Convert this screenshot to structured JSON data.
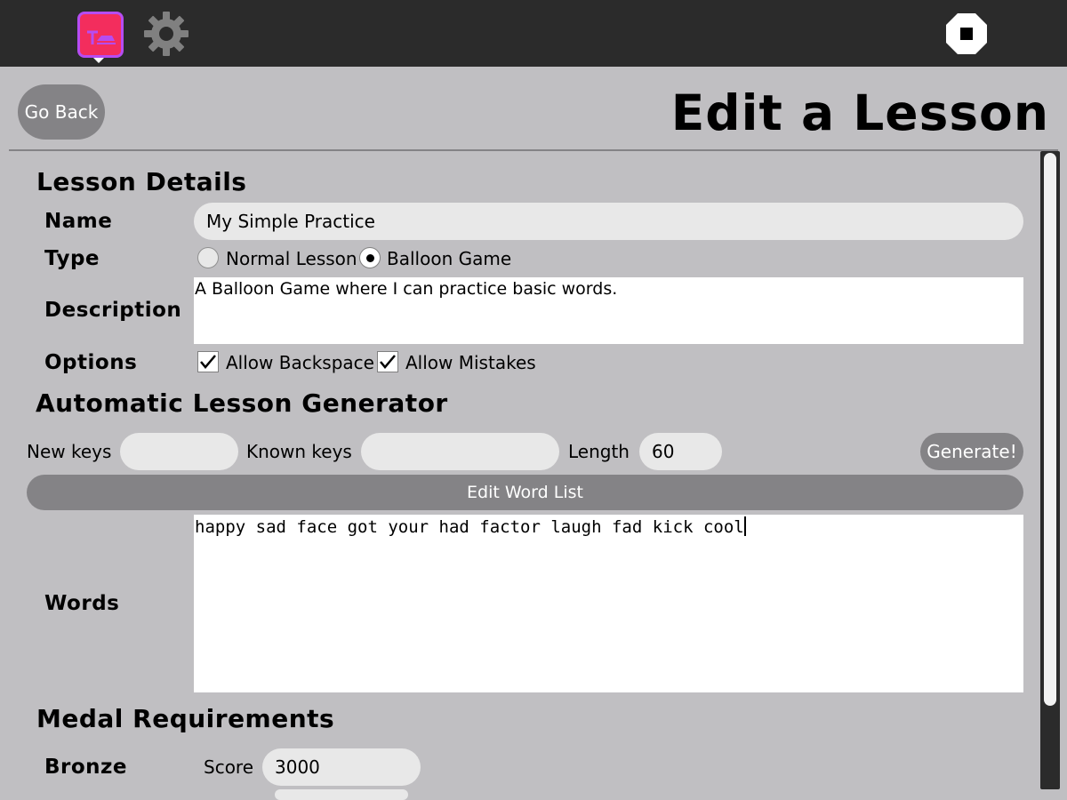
{
  "toolbar": {
    "activity_icon": "typing-activity-icon",
    "settings_icon": "gear-icon",
    "stop_icon": "stop-icon",
    "colors": {
      "bar": "#2b2b2b",
      "activity_fill": "#f32d5d",
      "activity_border": "#b64cf2"
    }
  },
  "header": {
    "back_label": "Go Back",
    "title": "Edit a Lesson"
  },
  "details": {
    "heading": "Lesson Details",
    "name_label": "Name",
    "name_value": "My Simple Practice",
    "type_label": "Type",
    "type_options": [
      {
        "label": "Normal Lesson",
        "selected": false
      },
      {
        "label": "Balloon Game",
        "selected": true
      }
    ],
    "description_label": "Description",
    "description_value": "A Balloon Game where I can practice basic words.",
    "options_label": "Options",
    "options": [
      {
        "label": "Allow Backspace",
        "checked": true
      },
      {
        "label": "Allow Mistakes",
        "checked": true
      }
    ]
  },
  "generator": {
    "heading": "Automatic Lesson Generator",
    "new_keys_label": "New keys",
    "new_keys_value": "",
    "known_keys_label": "Known keys",
    "known_keys_value": "",
    "length_label": "Length",
    "length_value": "60",
    "generate_label": "Generate!",
    "edit_word_list_label": "Edit Word List",
    "words_label": "Words",
    "words_value": "happy sad face got your had factor laugh fad kick cool"
  },
  "medals": {
    "heading": "Medal Requirements",
    "bronze_label": "Bronze",
    "score_label": "Score",
    "bronze_score": "3000"
  }
}
